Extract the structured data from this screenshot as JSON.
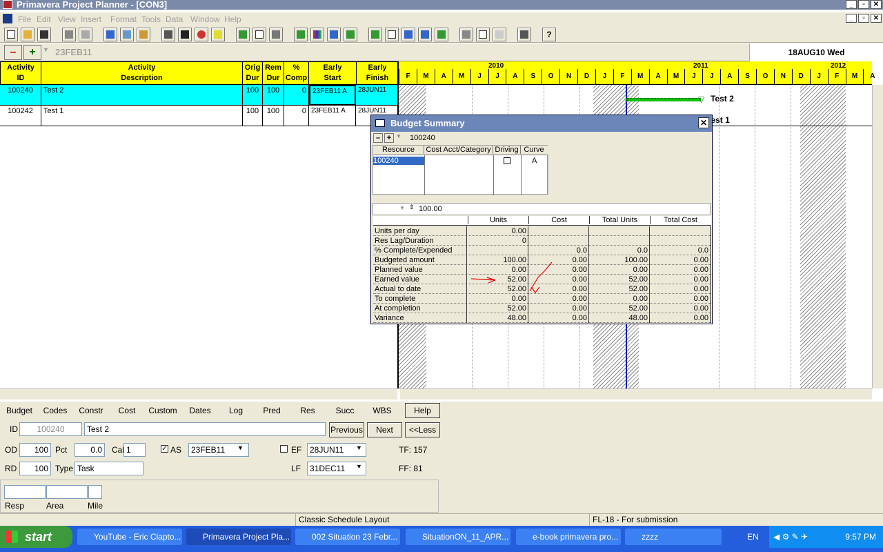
{
  "window": {
    "title": "Primavera Project Planner - [CON3]"
  },
  "menu": [
    "File",
    "Edit",
    "View",
    "Insert",
    "Format",
    "Tools",
    "Data",
    "Window",
    "Help"
  ],
  "editbar": {
    "value": "23FEB11",
    "date": "18AUG10 Wed",
    "minus": "–",
    "plus": "+"
  },
  "grid": {
    "headers": [
      {
        "l1": "Activity",
        "l2": "ID"
      },
      {
        "l1": "Activity",
        "l2": "Description"
      },
      {
        "l1": "Orig",
        "l2": "Dur"
      },
      {
        "l1": "Rem",
        "l2": "Dur"
      },
      {
        "l1": "%",
        "l2": "Comp"
      },
      {
        "l1": "Early",
        "l2": "Start"
      },
      {
        "l1": "Early",
        "l2": "Finish"
      }
    ],
    "rows": [
      {
        "id": "100240",
        "desc": "Test 2",
        "od": "100",
        "rd": "100",
        "pct": "0",
        "es": "23FEB11 A",
        "ef": "28JUN11"
      },
      {
        "id": "100242",
        "desc": "Test 1",
        "od": "100",
        "rd": "100",
        "pct": "0",
        "es": "23FEB11 A",
        "ef": "28JUN11"
      }
    ]
  },
  "timeline": {
    "years": [
      "2010",
      "2011",
      "2012"
    ],
    "months": [
      "F",
      "M",
      "A",
      "M",
      "J",
      "J",
      "A",
      "S",
      "O",
      "N",
      "D",
      "J",
      "F",
      "M",
      "A",
      "M",
      "J",
      "J",
      "A",
      "S",
      "O",
      "N",
      "D",
      "J",
      "F",
      "M",
      "A"
    ],
    "bar_labels": [
      "Test 2",
      "Test 1"
    ]
  },
  "budget": {
    "title": "Budget Summary",
    "activity": "100240",
    "res_headers": [
      "Resource",
      "Cost Acct/Category",
      "Driving",
      "Curve"
    ],
    "res_row": {
      "resource": "100240",
      "cost_acct": "",
      "curve": "A"
    },
    "edit_value": "100.00",
    "col_headers": [
      "Units",
      "Cost",
      "Total Units",
      "Total Cost"
    ],
    "rows": [
      {
        "label": "Units per day",
        "units": "0.00",
        "cost": "",
        "tunits": "",
        "tcost": ""
      },
      {
        "label": "Res Lag/Duration",
        "units": "0",
        "cost": "",
        "tunits": "",
        "tcost": ""
      },
      {
        "label": "% Complete/Expended",
        "units": "",
        "cost": "0.0",
        "tunits": "0.0",
        "tcost": "0.0"
      },
      {
        "label": "Budgeted amount",
        "units": "100.00",
        "cost": "0.00",
        "tunits": "100.00",
        "tcost": "0.00"
      },
      {
        "label": "Planned value",
        "units": "0.00",
        "cost": "0.00",
        "tunits": "0.00",
        "tcost": "0.00"
      },
      {
        "label": "Earned value",
        "units": "52.00",
        "cost": "0.00",
        "tunits": "52.00",
        "tcost": "0.00"
      },
      {
        "label": "Actual to date",
        "units": "52.00",
        "cost": "0.00",
        "tunits": "52.00",
        "tcost": "0.00"
      },
      {
        "label": "To complete",
        "units": "0.00",
        "cost": "0.00",
        "tunits": "0.00",
        "tcost": "0.00"
      },
      {
        "label": "At completion",
        "units": "52.00",
        "cost": "0.00",
        "tunits": "52.00",
        "tcost": "0.00"
      },
      {
        "label": "Variance",
        "units": "48.00",
        "cost": "0.00",
        "tunits": "48.00",
        "tcost": "0.00"
      }
    ]
  },
  "form": {
    "tabs": [
      "Budget",
      "Codes",
      "Constr",
      "Cost",
      "Custom",
      "Dates",
      "Log",
      "Pred",
      "Res",
      "Succ",
      "WBS"
    ],
    "help": "Help",
    "id_label": "ID",
    "id_value": "100240",
    "desc_value": "Test 2",
    "previous": "Previous",
    "next": "Next",
    "less": "<<Less",
    "od_label": "OD",
    "od_value": "100",
    "pct_label": "Pct",
    "pct_value": "0.0",
    "cal_label": "Cal",
    "cal_value": "1",
    "as_label": "AS",
    "as_value": "23FEB11",
    "ef_label": "EF",
    "ef_value": "28JUN11",
    "tf": "TF:  157",
    "rd_label": "RD",
    "rd_value": "100",
    "type_label": "Type",
    "type_value": "Task",
    "lf_label": "LF",
    "lf_value": "31DEC11",
    "ff": "FF:  81",
    "resp_label": "Resp",
    "area_label": "Area",
    "mile_label": "Mile"
  },
  "status": {
    "layout": "Classic Schedule Layout",
    "filter": "FL-18 - For submission"
  },
  "taskbar": {
    "start": "start",
    "tasks": [
      "YouTube - Eric Clapto...",
      "Primavera Project Pla...",
      "002 Situation 23 Febr...",
      "SituationON_11_APR...",
      "e-book primavera pro...",
      "zzzz"
    ],
    "lang": "EN",
    "time": "9:57 PM"
  }
}
